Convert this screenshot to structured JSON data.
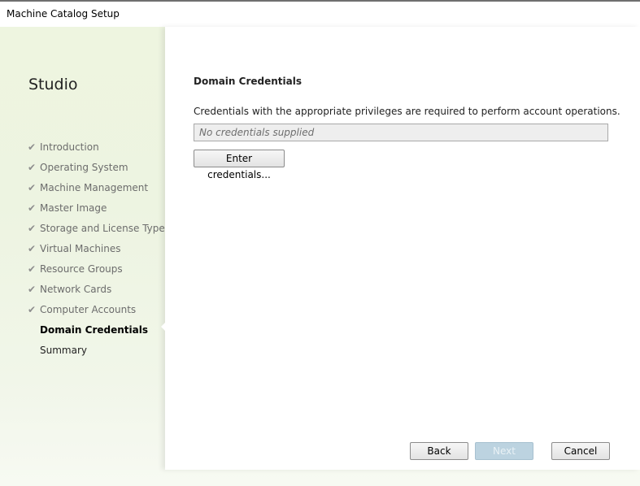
{
  "window": {
    "title": "Machine Catalog Setup"
  },
  "sidebar": {
    "brand": "Studio",
    "steps": [
      {
        "label": "Introduction",
        "state": "done"
      },
      {
        "label": "Operating System",
        "state": "done"
      },
      {
        "label": "Machine Management",
        "state": "done"
      },
      {
        "label": "Master Image",
        "state": "done"
      },
      {
        "label": "Storage and License Types",
        "state": "done"
      },
      {
        "label": "Virtual Machines",
        "state": "done"
      },
      {
        "label": "Resource Groups",
        "state": "done"
      },
      {
        "label": "Network Cards",
        "state": "done"
      },
      {
        "label": "Computer Accounts",
        "state": "done"
      },
      {
        "label": "Domain Credentials",
        "state": "current"
      },
      {
        "label": "Summary",
        "state": "future"
      }
    ],
    "check_glyph": "✔"
  },
  "main": {
    "heading": "Domain Credentials",
    "description": "Credentials with the appropriate privileges are required to perform account operations.",
    "credentials_value": "No credentials supplied",
    "enter_button": "Enter credentials..."
  },
  "footer": {
    "back": "Back",
    "next": "Next",
    "cancel": "Cancel"
  },
  "colors": {
    "sidebar_tint": "#eef5e0",
    "next_disabled": "#bcd3e0"
  }
}
